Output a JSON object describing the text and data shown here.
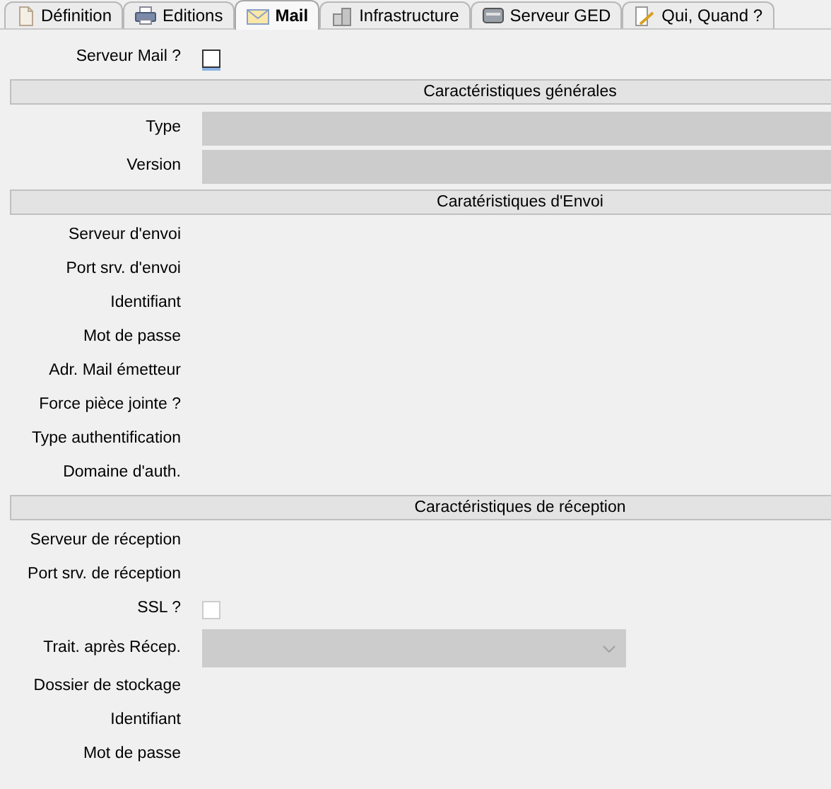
{
  "tabs": [
    {
      "label": "Définition",
      "selected": false
    },
    {
      "label": "Editions",
      "selected": false
    },
    {
      "label": "Mail",
      "selected": true
    },
    {
      "label": "Infrastructure",
      "selected": false
    },
    {
      "label": "Serveur GED",
      "selected": false
    },
    {
      "label": "Qui, Quand ?",
      "selected": false
    }
  ],
  "form": [
    {
      "kind": "checkbox",
      "label": "Serveur Mail ?",
      "checked": false,
      "disabled": false
    },
    {
      "kind": "section",
      "title": "Caractéristiques générales"
    },
    {
      "kind": "field",
      "label": "Type",
      "disabled": true
    },
    {
      "kind": "field",
      "label": "Version",
      "disabled": true
    },
    {
      "kind": "section",
      "title": "Caratéristiques d'Envoi"
    },
    {
      "kind": "label",
      "label": "Serveur d'envoi"
    },
    {
      "kind": "label",
      "label": "Port srv. d'envoi"
    },
    {
      "kind": "label",
      "label": "Identifiant"
    },
    {
      "kind": "label",
      "label": "Mot de passe"
    },
    {
      "kind": "label",
      "label": "Adr. Mail émetteur"
    },
    {
      "kind": "label",
      "label": "Force pièce jointe ?"
    },
    {
      "kind": "label",
      "label": "Type authentification"
    },
    {
      "kind": "label",
      "label": "Domaine d'auth."
    },
    {
      "kind": "section",
      "title": "Caractéristiques de réception"
    },
    {
      "kind": "label",
      "label": "Serveur de réception"
    },
    {
      "kind": "label",
      "label": "Port srv. de réception"
    },
    {
      "kind": "checkbox",
      "label": "SSL ?",
      "checked": false,
      "disabled": true
    },
    {
      "kind": "combo",
      "label": "Trait. après Récep.",
      "disabled": true
    },
    {
      "kind": "label",
      "label": "Dossier de stockage"
    },
    {
      "kind": "label",
      "label": "Identifiant"
    },
    {
      "kind": "label",
      "label": "Mot de passe"
    }
  ]
}
